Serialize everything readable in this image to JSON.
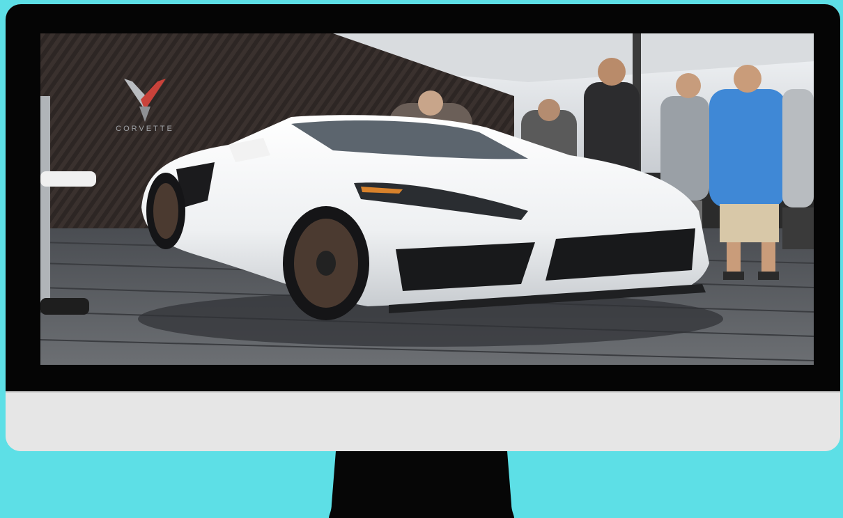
{
  "scene": {
    "monitor_frame_color": "#050505",
    "monitor_chin_color": "#e6e6e6",
    "background_color": "#5ddfe6",
    "brand_logo_icon": "corvette-crossed-flags-icon"
  },
  "photo": {
    "logo_wordmark": "CORVETTE"
  }
}
